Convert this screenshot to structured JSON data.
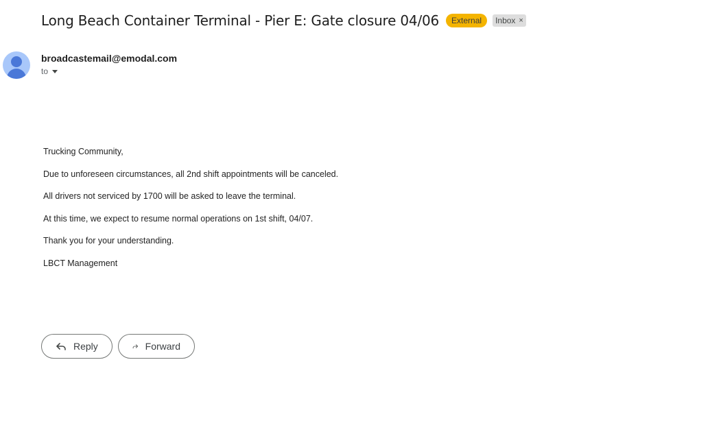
{
  "email": {
    "subject": "Long Beach Container Terminal - Pier E: Gate closure 04/06",
    "labels": {
      "external": "External",
      "inbox": "Inbox",
      "remove_symbol": "×"
    },
    "sender": "broadcastemail@emodal.com",
    "recipient_label": "to",
    "body": [
      "Trucking Community,",
      "Due to unforeseen circumstances, all 2nd shift appointments will be canceled.",
      "All drivers not serviced by 1700 will be asked to leave the terminal.",
      "At this time, we expect to resume normal operations on 1st shift, 04/07.",
      "Thank you for your understanding.",
      "LBCT Management"
    ]
  },
  "actions": {
    "reply_label": "Reply",
    "forward_label": "Forward"
  },
  "icons": {
    "avatar": "person-avatar-icon",
    "reply": "reply-arrow-icon",
    "forward": "forward-arrow-icon",
    "expand": "caret-down-icon"
  },
  "colors": {
    "external_badge": "#f4b400",
    "inbox_badge": "#dddddd",
    "avatar_bg": "#a8c7fa",
    "avatar_fg": "#4a78d8"
  }
}
